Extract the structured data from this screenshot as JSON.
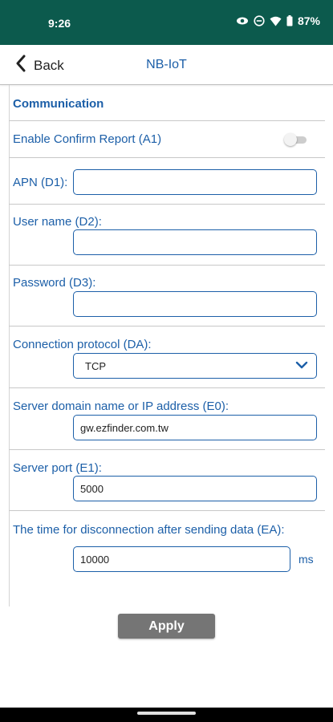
{
  "status_bar": {
    "time": "9:26",
    "battery": "87%",
    "icons": [
      "eye-icon",
      "do-not-disturb-icon",
      "wifi-icon",
      "battery-icon"
    ]
  },
  "nav": {
    "back_label": "Back",
    "title": "NB-IoT"
  },
  "section": {
    "title": "Communication"
  },
  "fields": {
    "confirm_report": {
      "label": "Enable Confirm Report (A1)",
      "enabled": false
    },
    "apn": {
      "label": "APN (D1):",
      "value": ""
    },
    "username": {
      "label": "User name (D2):",
      "value": ""
    },
    "password": {
      "label": "Password (D3):",
      "value": ""
    },
    "protocol": {
      "label": "Connection protocol (DA):",
      "selected": "TCP"
    },
    "server_address": {
      "label": "Server domain name or IP address (E0):",
      "value": "gw.ezfinder.com.tw"
    },
    "server_port": {
      "label": "Server port (E1):",
      "value": "5000"
    },
    "disconnect_time": {
      "label": "The time for disconnection after sending data (EA):",
      "value": "10000",
      "unit": "ms"
    }
  },
  "apply_label": "Apply",
  "colors": {
    "status_bar": "#0c5a4d",
    "accent": "#1c5fa8",
    "button": "#757575"
  }
}
